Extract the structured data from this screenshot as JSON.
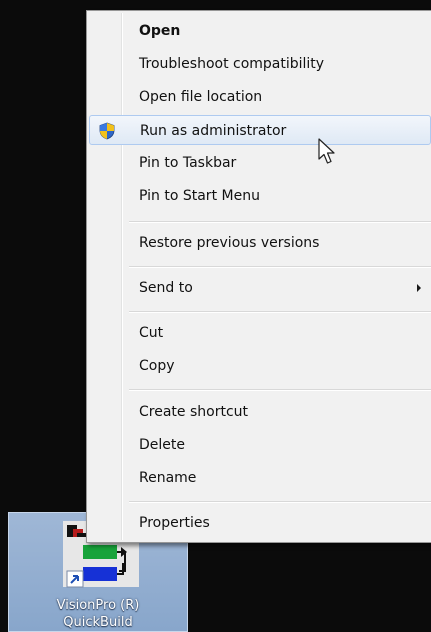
{
  "context_menu": {
    "items": [
      {
        "label": "Open"
      },
      {
        "label": "Troubleshoot compatibility"
      },
      {
        "label": "Open file location"
      },
      {
        "label": "Run as administrator",
        "icon": "uac-shield-icon"
      },
      {
        "label": "Pin to Taskbar"
      },
      {
        "label": "Pin to Start Menu"
      },
      {
        "label": "Restore previous versions"
      },
      {
        "label": "Send to",
        "submenu": true
      },
      {
        "label": "Cut"
      },
      {
        "label": "Copy"
      },
      {
        "label": "Create shortcut"
      },
      {
        "label": "Delete"
      },
      {
        "label": "Rename"
      },
      {
        "label": "Properties"
      }
    ],
    "hover_index": 3,
    "colors": {
      "hover_border": "#aecaf0",
      "menu_bg": "#f1f1f1"
    }
  },
  "desktop_icon": {
    "label_line1": "VisionPro (R)",
    "label_line2": "QuickBuild",
    "icon": "visionpro-quickbuild-shortcut-icon",
    "selected": true
  },
  "cursor": {
    "icon": "mouse-pointer-icon"
  }
}
